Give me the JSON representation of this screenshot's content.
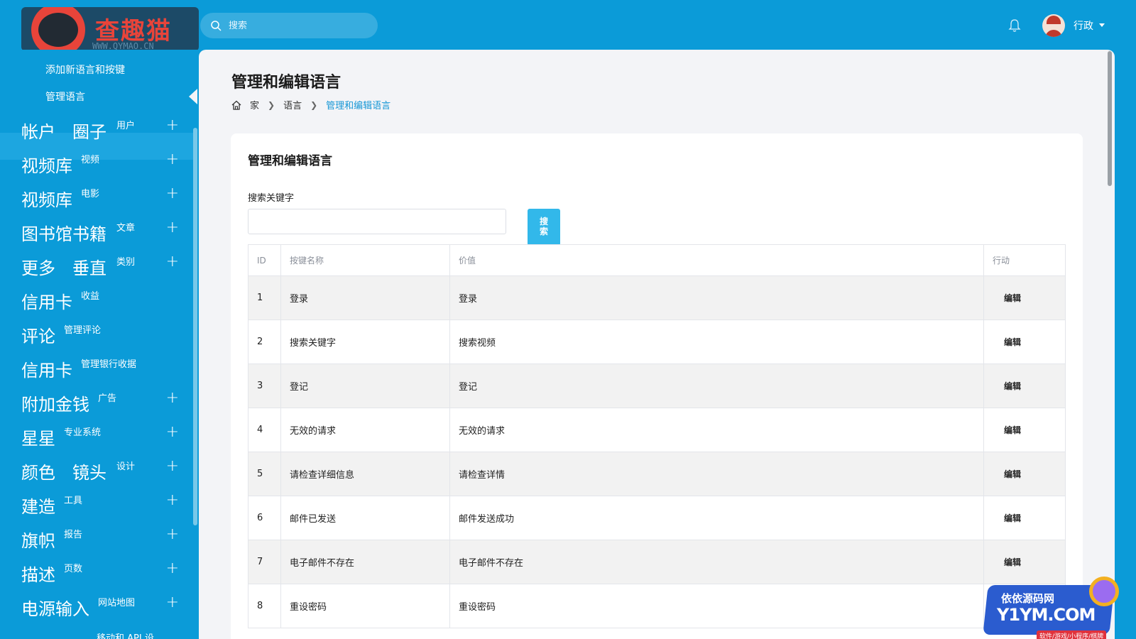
{
  "brand": {
    "logo_text": "查趣猫",
    "logo_sub": "WWW.QYMAO.CN"
  },
  "header": {
    "search_placeholder": "搜索",
    "user_name": "行政"
  },
  "sidebar": {
    "sub_items": [
      {
        "label": "添加新语言和按键"
      },
      {
        "label": "管理语言"
      }
    ],
    "items": [
      {
        "main": "帐户　圈子",
        "sub": "用户",
        "plus": "+"
      },
      {
        "main": "视频库",
        "sub": "视频",
        "plus": "+"
      },
      {
        "main": "视频库",
        "sub": "电影",
        "plus": "+"
      },
      {
        "main": "图书馆书籍",
        "sub": "文章",
        "plus": "+"
      },
      {
        "main": "更多　垂直",
        "sub": "类别",
        "plus": "+"
      },
      {
        "main": "信用卡",
        "sub": "收益",
        "plus": ""
      },
      {
        "main": "评论",
        "sub": "管理评论",
        "plus": ""
      },
      {
        "main": "信用卡",
        "sub": "管理银行收据",
        "plus": ""
      },
      {
        "main": "附加金钱",
        "sub": "广告",
        "plus": "+"
      },
      {
        "main": "星星",
        "sub": "专业系统",
        "plus": "+"
      },
      {
        "main": "颜色　镜头",
        "sub": "设计",
        "plus": "+"
      },
      {
        "main": "建造",
        "sub": "工具",
        "plus": "+"
      },
      {
        "main": "旗帜",
        "sub": "报告",
        "plus": "+"
      },
      {
        "main": "描述",
        "sub": "页数",
        "plus": "+"
      },
      {
        "main": "电源输入",
        "sub": "网站地图",
        "plus": "+"
      }
    ],
    "bottom_partial": "移动和 API 设"
  },
  "page": {
    "title": "管理和编辑语言",
    "breadcrumb": [
      "家",
      "语言",
      "管理和编辑语言"
    ]
  },
  "card": {
    "title": "管理和编辑语言",
    "keyword_label": "搜索关键字",
    "search_button": "搜\n索",
    "table": {
      "headers": [
        "ID",
        "按键名称",
        "价值",
        "行动"
      ],
      "rows": [
        {
          "id": "1",
          "key": "登录",
          "value": "登录",
          "action": "编辑"
        },
        {
          "id": "2",
          "key": "搜索关键字",
          "value": "搜索视频",
          "action": "编辑"
        },
        {
          "id": "3",
          "key": "登记",
          "value": "登记",
          "action": "编辑"
        },
        {
          "id": "4",
          "key": "无效的请求",
          "value": "无效的请求",
          "action": "编辑"
        },
        {
          "id": "5",
          "key": "请检查详细信息",
          "value": "请检查详情",
          "action": "编辑"
        },
        {
          "id": "6",
          "key": "邮件已发送",
          "value": "邮件发送成功",
          "action": "编辑"
        },
        {
          "id": "7",
          "key": "电子邮件不存在",
          "value": "电子邮件不存在",
          "action": "编辑"
        },
        {
          "id": "8",
          "key": "重设密码",
          "value": "重设密码",
          "action": ""
        }
      ]
    }
  },
  "watermark": {
    "top": "依依源码网",
    "main": "Y1YM.COM",
    "foot": "软件/游戏/小程序/棋牌"
  },
  "colors": {
    "primary": "#0b9bd8",
    "accent": "#32b8ea",
    "link": "#1797d6"
  }
}
